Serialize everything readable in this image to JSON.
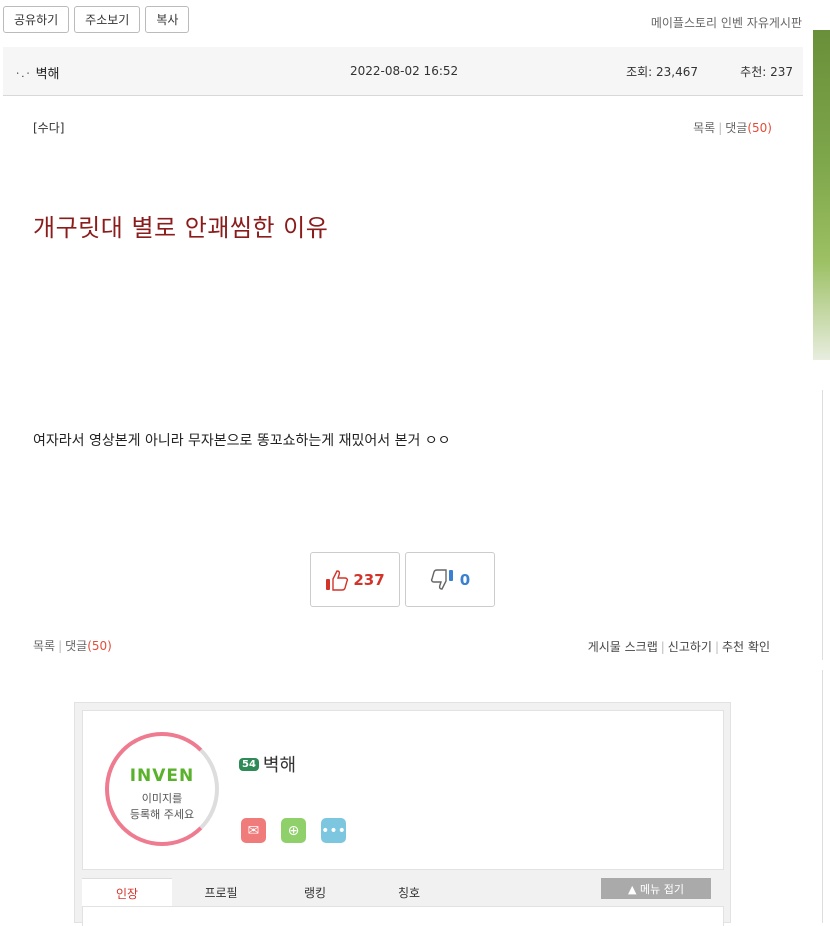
{
  "toolbar": {
    "share": "공유하기",
    "address": "주소보기",
    "copy": "복사"
  },
  "board_name": "메이플스토리 인벤 자유게시판",
  "post": {
    "author": "벽해",
    "author_icon": "ㆍ.ㆍ",
    "date": "2022-08-02 16:52",
    "views_label": "조회: 23,467",
    "rec_label": "추천: 237",
    "category": "[수다]",
    "list_label": "목록",
    "comments_label": "댓글",
    "comments_count": "(50)",
    "title": "개구릿대 별로 안괘씸한 이유",
    "body": "여자라서 영상본게 아니라 무자본으로 똥꼬쇼하는게 재밌어서 본거 ㅇㅇ",
    "upvotes": "237",
    "downvotes": "0"
  },
  "actions": {
    "scrap": "게시물 스크랩",
    "report": "신고하기",
    "rec_check": "추천 확인"
  },
  "profile": {
    "logo": "INVEN",
    "logo_text_1": "이미지를",
    "logo_text_2": "등록해 주세요",
    "level": "54",
    "name": "벽해",
    "tabs": [
      "인장",
      "프로필",
      "랭킹",
      "칭호"
    ],
    "fold_label": "▲ 메뉴 접기"
  }
}
